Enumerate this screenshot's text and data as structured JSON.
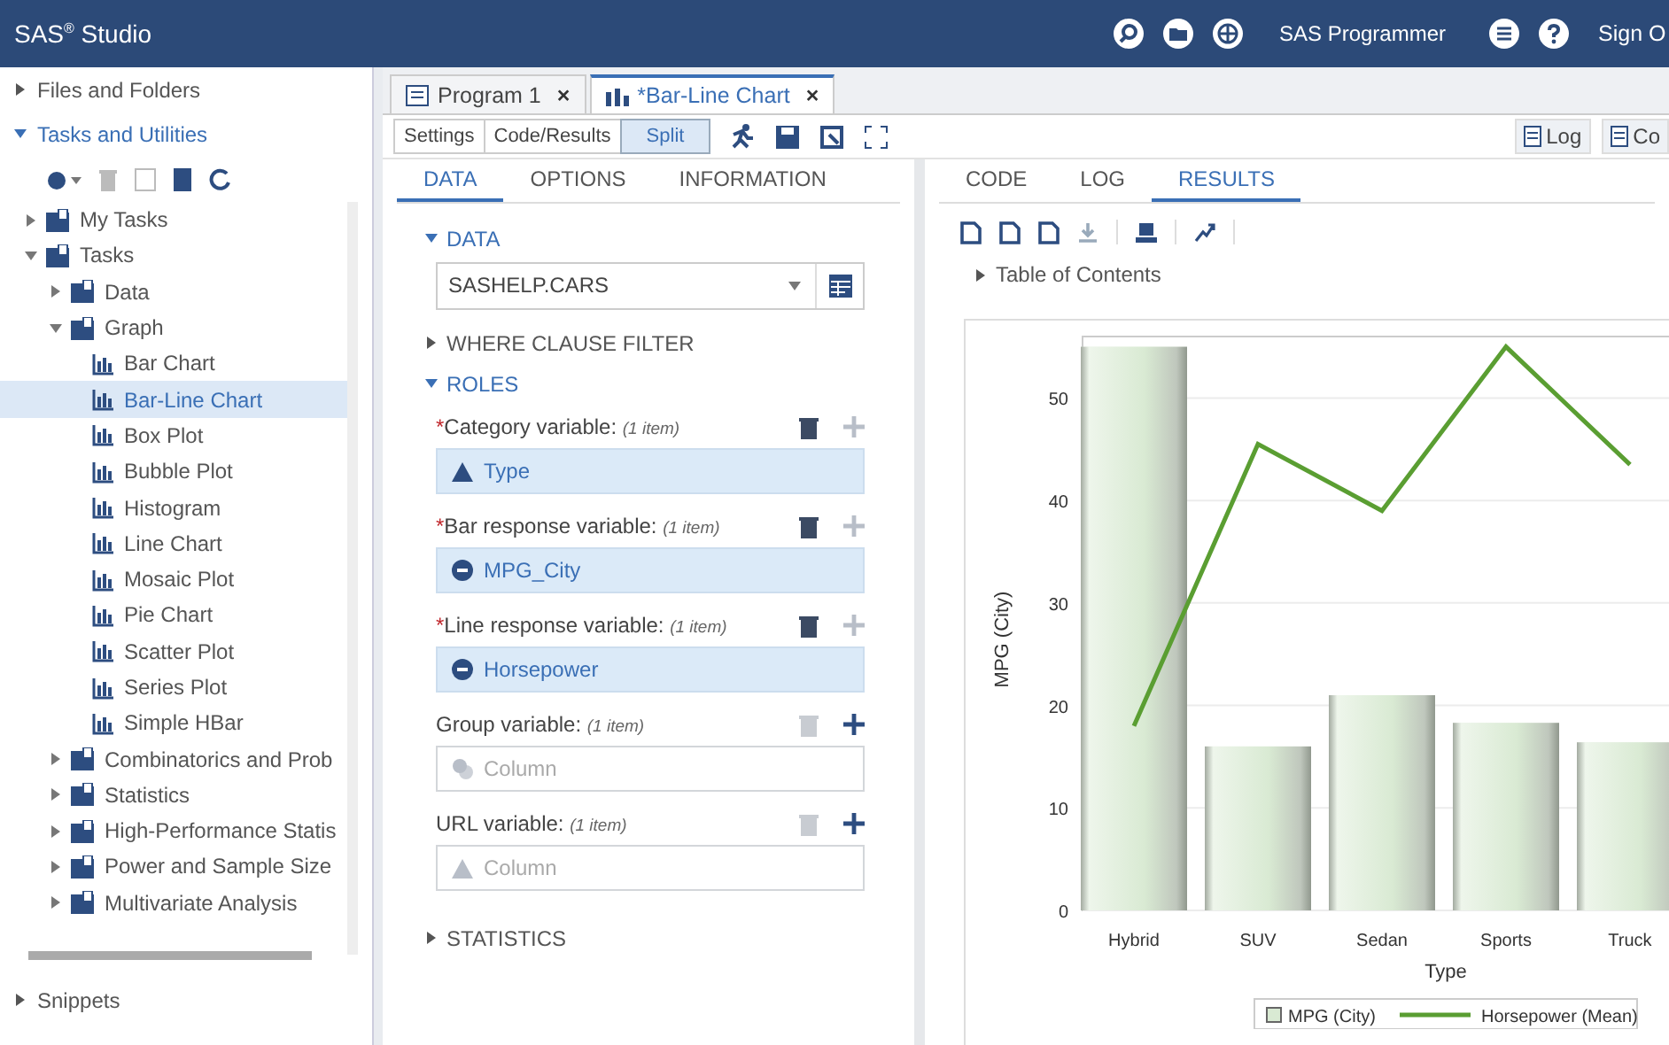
{
  "header": {
    "app_title": "SAS$^{®}$ Studio",
    "role_menu": "SAS Programmer",
    "sign_out": "Sign O"
  },
  "navigator": {
    "sections": [
      {
        "label": "Files and Folders",
        "expanded": false
      },
      {
        "label": "Tasks and Utilities",
        "expanded": true
      }
    ],
    "tree": [
      {
        "label": "My Tasks",
        "expanded": false
      },
      {
        "label": "Tasks",
        "expanded": true,
        "children": [
          {
            "label": "Data",
            "expanded": false
          },
          {
            "label": "Graph",
            "expanded": true,
            "children": [
              {
                "label": "Bar Chart",
                "selected": false
              },
              {
                "label": "Bar-Line Chart",
                "selected": true
              },
              {
                "label": "Box Plot",
                "selected": false
              },
              {
                "label": "Bubble Plot",
                "selected": false
              },
              {
                "label": "Histogram",
                "selected": false
              },
              {
                "label": "Line Chart",
                "selected": false
              },
              {
                "label": "Mosaic Plot",
                "selected": false
              },
              {
                "label": "Pie Chart",
                "selected": false
              },
              {
                "label": "Scatter Plot",
                "selected": false
              },
              {
                "label": "Series Plot",
                "selected": false
              },
              {
                "label": "Simple HBar",
                "selected": false
              }
            ]
          },
          {
            "label": "Combinatorics and Prob",
            "expanded": false
          },
          {
            "label": "Statistics",
            "expanded": false
          },
          {
            "label": "High-Performance Statis",
            "expanded": false
          },
          {
            "label": "Power and Sample Size",
            "expanded": false
          },
          {
            "label": "Multivariate Analysis",
            "expanded": false
          }
        ]
      }
    ],
    "bottom_sections": [
      {
        "label": "Snippets",
        "expanded": false
      }
    ]
  },
  "editor": {
    "tabs": [
      {
        "label": "Program 1",
        "close": "×",
        "selected": false
      },
      {
        "label": "*Bar-Line Chart",
        "close": "×",
        "selected": true
      }
    ],
    "view_buttons": [
      {
        "label": "Settings",
        "selected": false
      },
      {
        "label": "Code/Results",
        "selected": false
      },
      {
        "label": "Split",
        "selected": true
      }
    ],
    "right_buttons": [
      "Log",
      "Co"
    ]
  },
  "task": {
    "tabs": [
      {
        "label": "DATA",
        "selected": true
      },
      {
        "label": "OPTIONS",
        "selected": false
      },
      {
        "label": "INFORMATION",
        "selected": false
      }
    ],
    "data_section": {
      "label": "DATA",
      "expanded": true,
      "dataset": "SASHELP.CARS"
    },
    "filter_section": {
      "label": "WHERE CLAUSE FILTER",
      "expanded": false
    },
    "roles_section": {
      "label": "ROLES",
      "expanded": true
    },
    "roles": [
      {
        "required": true,
        "required_mark": "*",
        "label": "Category variable:",
        "count": "(1 item)",
        "value": "Type",
        "kind": "character"
      },
      {
        "required": true,
        "required_mark": "*",
        "label": "Bar response variable:",
        "count": "(1 item)",
        "value": "MPG_City",
        "kind": "numeric"
      },
      {
        "required": true,
        "required_mark": "*",
        "label": "Line response variable:",
        "count": "(1 item)",
        "value": "Horsepower",
        "kind": "numeric"
      },
      {
        "required": false,
        "label": "Group variable:",
        "count": "(1 item)",
        "placeholder": "Column",
        "kind": "mixed"
      },
      {
        "required": false,
        "label": "URL variable:",
        "count": "(1 item)",
        "placeholder": "Column",
        "kind": "character"
      }
    ],
    "statistics_section": {
      "label": "STATISTICS",
      "expanded": false
    }
  },
  "results": {
    "tabs": [
      {
        "label": "CODE",
        "selected": false
      },
      {
        "label": "LOG",
        "selected": false
      },
      {
        "label": "RESULTS",
        "selected": true
      }
    ],
    "toc": {
      "label": "Table of Contents",
      "expanded": false
    },
    "chart_data": {
      "type": "bar",
      "xlabel": "Type",
      "ylabel": "MPG (City)",
      "categories": [
        "Hybrid",
        "SUV",
        "Sedan",
        "Sports",
        "Truck"
      ],
      "series": [
        {
          "name": "MPG (City)",
          "type": "bar",
          "color": "#d9ead3",
          "values": [
            55,
            16,
            21,
            18.3,
            16.4
          ]
        },
        {
          "name": "Horsepower (Mean)",
          "type": "line",
          "color": "#5a9e32",
          "values": [
            18,
            45.5,
            39,
            55,
            43.5
          ]
        }
      ],
      "ylim": [
        0,
        56
      ],
      "yticks": [
        0,
        10,
        20,
        30,
        40,
        50
      ],
      "grid": true,
      "legend": true
    }
  }
}
